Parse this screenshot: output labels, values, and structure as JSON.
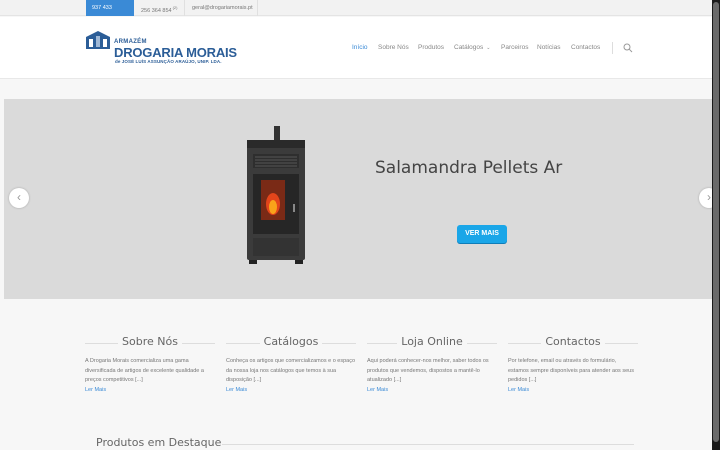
{
  "topbar": {
    "phone1": "937 433 422",
    "phone1_sup": "(1)",
    "phone2": "256 364 854",
    "phone2_sup": "(2)",
    "email": "geral@drogariamorais.pt"
  },
  "logo": {
    "small": "ARMAZÉM",
    "big": "DROGARIA MORAIS",
    "sub": "de JOSÉ LUÍS ASSUNÇÃO ARAÚJO, UNIP. LDA.",
    "color": "#2b5d97"
  },
  "nav": {
    "items": [
      "Início",
      "Sobre Nós",
      "Produtos",
      "Catálogos",
      "Parceiros",
      "Notícias",
      "Contactos"
    ],
    "active_color": "#3a8ad6"
  },
  "slider": {
    "title": "Salamandra Pellets Ar",
    "button": "VER MAIS"
  },
  "columns": [
    {
      "title": "Sobre Nós",
      "text": "A Drogaria Morais comercializa uma gama diversificada de artigos de excelente qualidade a preços competitivos [...]",
      "link": "Ler Mais"
    },
    {
      "title": "Catálogos",
      "text": "Conheça os artigos que comercializamos e o espaço da nossa loja nos catálogos que temos à sua disposição [...]",
      "link": "Ler Mais"
    },
    {
      "title": "Loja Online",
      "text": "Aqui poderá conhecer-nos melhor, saber todos os produtos que vendemos, dispostos a mantê-lo atualizado [...]",
      "link": "Ler Mais"
    },
    {
      "title": "Contactos",
      "text": "Por telefone, email ou através do formulário, estamos sempre disponíveis para atender aos seus pedidos [...]",
      "link": "Ler Mais"
    }
  ],
  "featured": "Produtos em Destaque"
}
